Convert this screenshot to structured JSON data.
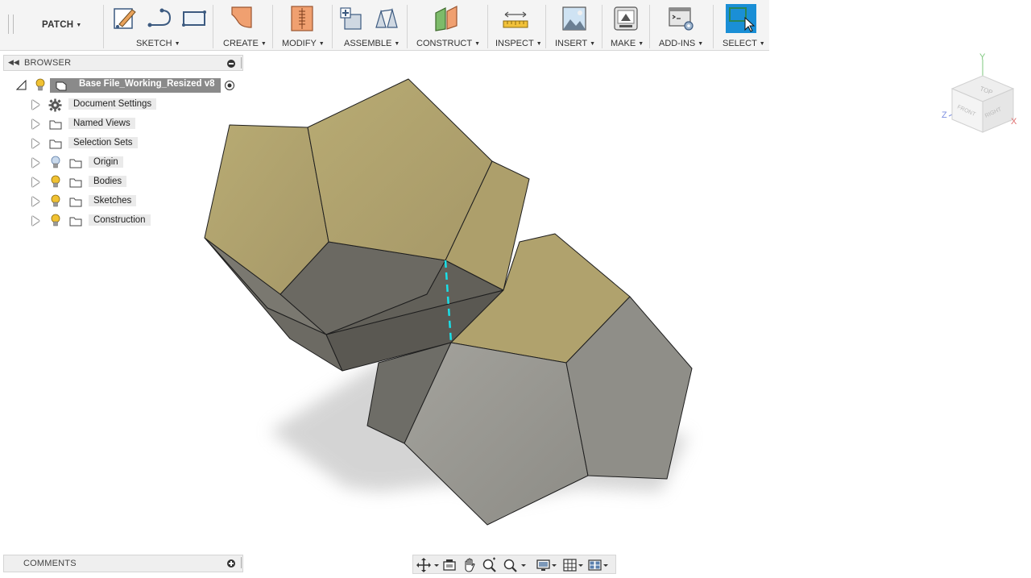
{
  "toolbar": {
    "workspace": "PATCH",
    "groups": {
      "sketch": "SKETCH",
      "create": "CREATE",
      "modify": "MODIFY",
      "assemble": "ASSEMBLE",
      "construct": "CONSTRUCT",
      "inspect": "INSPECT",
      "insert": "INSERT",
      "make": "MAKE",
      "addins": "ADD-INS",
      "select": "SELECT"
    }
  },
  "browser": {
    "title": "BROWSER",
    "root": "Base File_Working_Resized v8",
    "items": [
      {
        "label": "Document Settings",
        "icon": "gear-icon"
      },
      {
        "label": "Named Views",
        "icon": "folder-icon"
      },
      {
        "label": "Selection Sets",
        "icon": "folder-icon"
      },
      {
        "label": "Origin",
        "icon": "folder-icon"
      },
      {
        "label": "Bodies",
        "icon": "folder-icon"
      },
      {
        "label": "Sketches",
        "icon": "folder-icon"
      },
      {
        "label": "Construction",
        "icon": "folder-icon"
      }
    ]
  },
  "comments": {
    "title": "COMMENTS"
  },
  "viewcube": {
    "top": "TOP",
    "front": "FRONT",
    "right": "RIGHT",
    "axis_x": "X",
    "axis_y": "Y",
    "axis_z": "Z"
  },
  "colors": {
    "face_tan": "#b2a46d",
    "face_gray": "#9b9a94",
    "face_dark": "#6e6c64",
    "edge_highlight": "#19e0e8",
    "select_active": "#1a8fd6",
    "bulb_on": "#f1c232",
    "bulb_off": "#9db8d8"
  }
}
